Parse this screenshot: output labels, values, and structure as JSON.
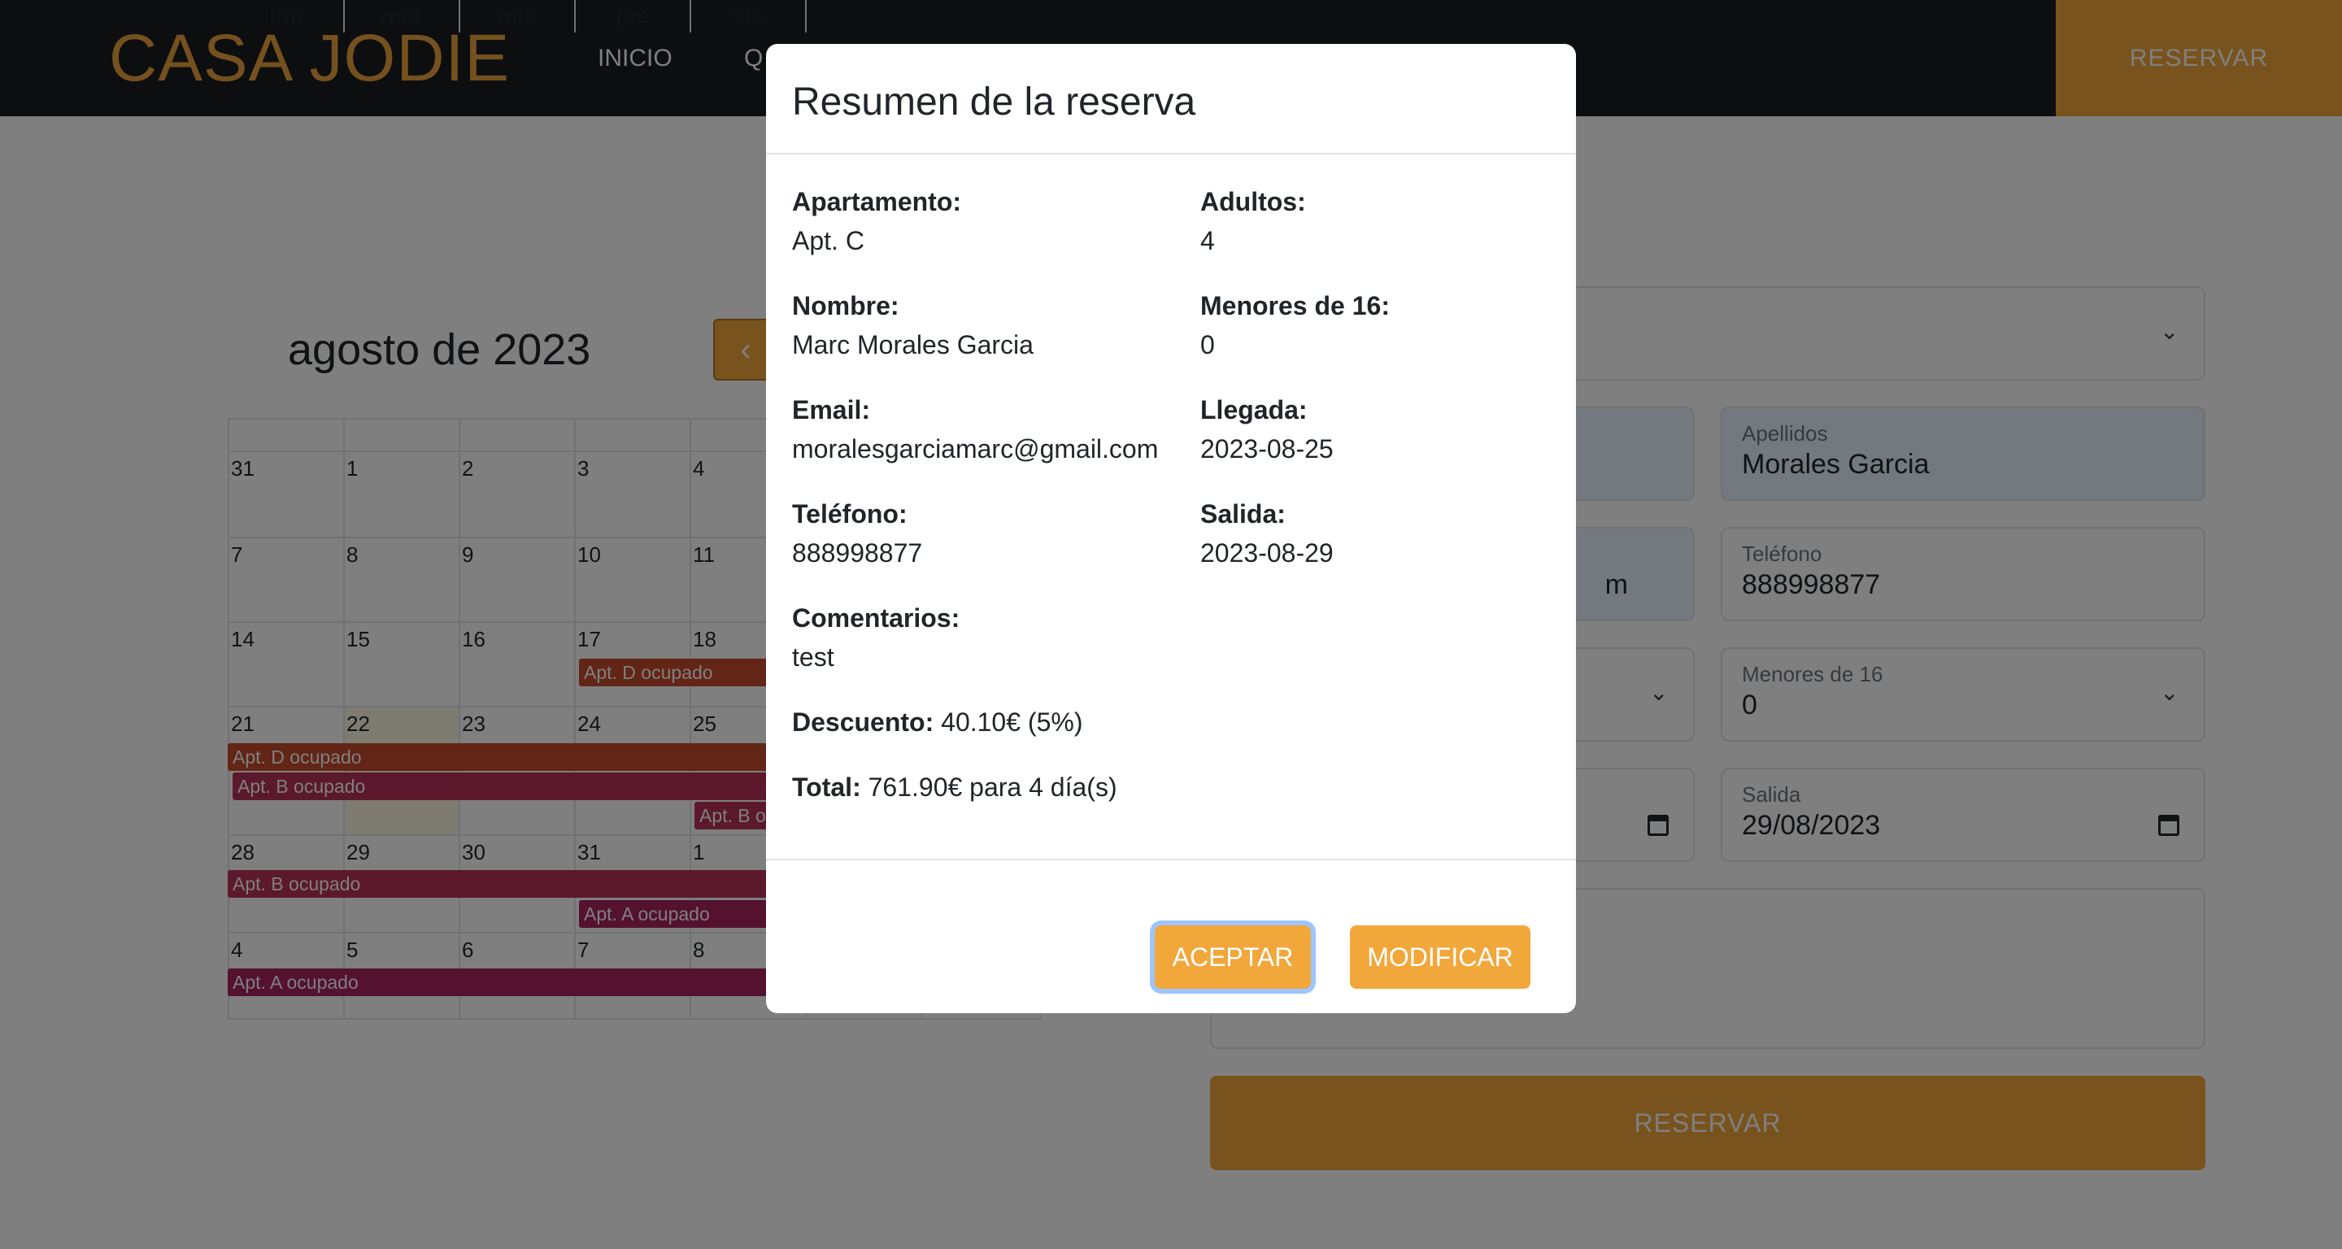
{
  "nav": {
    "brand": "CASA JODIE",
    "links": [
      "INICIO",
      "Q"
    ],
    "reserve": "RESERVAR"
  },
  "calendar": {
    "title": "agosto de 2023",
    "weekdays": [
      "lun",
      "mar",
      "mié",
      "jue",
      "vie"
    ],
    "weeks": [
      [
        "31",
        "1",
        "2",
        "3",
        "4"
      ],
      [
        "7",
        "8",
        "9",
        "10",
        "11"
      ],
      [
        "14",
        "15",
        "16",
        "17",
        "18"
      ],
      [
        "21",
        "22",
        "23",
        "24",
        "25"
      ],
      [
        "28",
        "29",
        "30",
        "31",
        "1"
      ],
      [
        "4",
        "5",
        "6",
        "7",
        "8"
      ]
    ],
    "events": [
      {
        "label": "Apt. D ocupado",
        "color": "#c54a2c"
      },
      {
        "label": "Apt. D ocupado",
        "color": "#c54a2c"
      },
      {
        "label": "Apt. B ocupado",
        "color": "#b8325b"
      },
      {
        "label": "Apt. B o",
        "color": "#b8325b"
      },
      {
        "label": "Apt. B ocupado",
        "color": "#b8325b"
      },
      {
        "label": "Apt. A ocupado",
        "color": "#a8245e"
      },
      {
        "label": "Apt. A ocupado",
        "color": "#a8245e"
      }
    ]
  },
  "form": {
    "apellidos_label": "Apellidos",
    "apellidos_value": "Morales Garcia",
    "email_value_tail": "m",
    "telefono_label": "Teléfono",
    "telefono_value": "888998877",
    "menores_label": "Menores de 16",
    "menores_value": "0",
    "salida_label": "Salida",
    "salida_value": "29/08/2023",
    "submit": "RESERVAR"
  },
  "modal": {
    "title": "Resumen de la reserva",
    "apartamento_label": "Apartamento:",
    "apartamento_value": "Apt. C",
    "adultos_label": "Adultos:",
    "adultos_value": "4",
    "nombre_label": "Nombre:",
    "nombre_value": "Marc Morales Garcia",
    "menores_label": "Menores de 16:",
    "menores_value": "0",
    "email_label": "Email:",
    "email_value": "moralesgarciamarc@gmail.com",
    "llegada_label": "Llegada:",
    "llegada_value": "2023-08-25",
    "telefono_label": "Teléfono:",
    "telefono_value": "888998877",
    "salida_label": "Salida:",
    "salida_value": "2023-08-29",
    "comentarios_label": "Comentarios:",
    "comentarios_value": "test",
    "descuento_label": "Descuento:",
    "descuento_value": "40.10€ (5%)",
    "total_label": "Total:",
    "total_value": "761.90€ para 4 día(s)",
    "accept": "ACEPTAR",
    "modify": "MODIFICAR"
  },
  "colors": {
    "accent": "#f2a73b",
    "navbar": "#1a1d21",
    "backdrop": "rgba(0,0,0,0.5)"
  }
}
